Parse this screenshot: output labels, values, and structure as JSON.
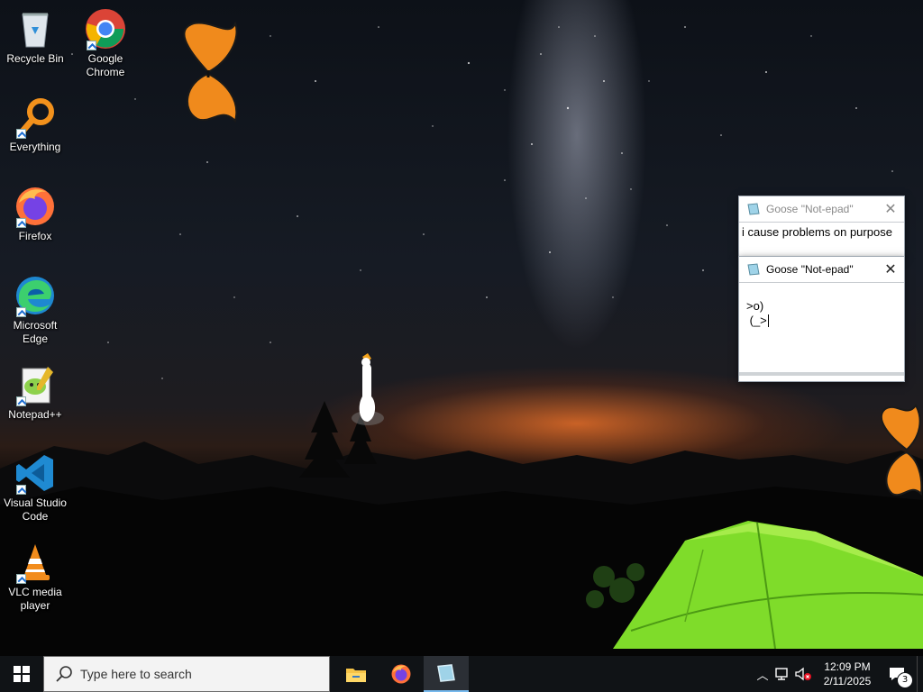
{
  "desktop": {
    "icons": [
      {
        "label": "Recycle Bin",
        "icon": "recycle-bin-icon"
      },
      {
        "label": "Google\nChrome",
        "icon": "chrome-icon"
      },
      {
        "label": "Everything",
        "icon": "everything-icon"
      },
      {
        "label": "Firefox",
        "icon": "firefox-icon"
      },
      {
        "label": "Microsoft\nEdge",
        "icon": "edge-icon"
      },
      {
        "label": "Notepad++",
        "icon": "notepadpp-icon"
      },
      {
        "label": "Visual Studio\nCode",
        "icon": "vscode-icon"
      },
      {
        "label": "VLC media\nplayer",
        "icon": "vlc-icon"
      }
    ]
  },
  "notepad_top": {
    "title": "Goose \"Not-epad\"",
    "text": "i cause problems on purpose"
  },
  "notepad_bottom": {
    "title": "Goose \"Not-epad\"",
    "line1": ">o)",
    "line2": " (_>"
  },
  "taskbar": {
    "search_placeholder": "Type here to search",
    "time": "12:09 PM",
    "date": "2/11/2025",
    "notification_count": "3",
    "apps": [
      "file-explorer-icon",
      "firefox-icon",
      "notepad-icon"
    ]
  },
  "colors": {
    "taskbar_bg": "#101316",
    "tent_green": "#7fdc2a",
    "sunset_orange": "#e8702a",
    "butterfly_orange": "#f08a1c",
    "vscode_blue": "#1f8ad2"
  }
}
